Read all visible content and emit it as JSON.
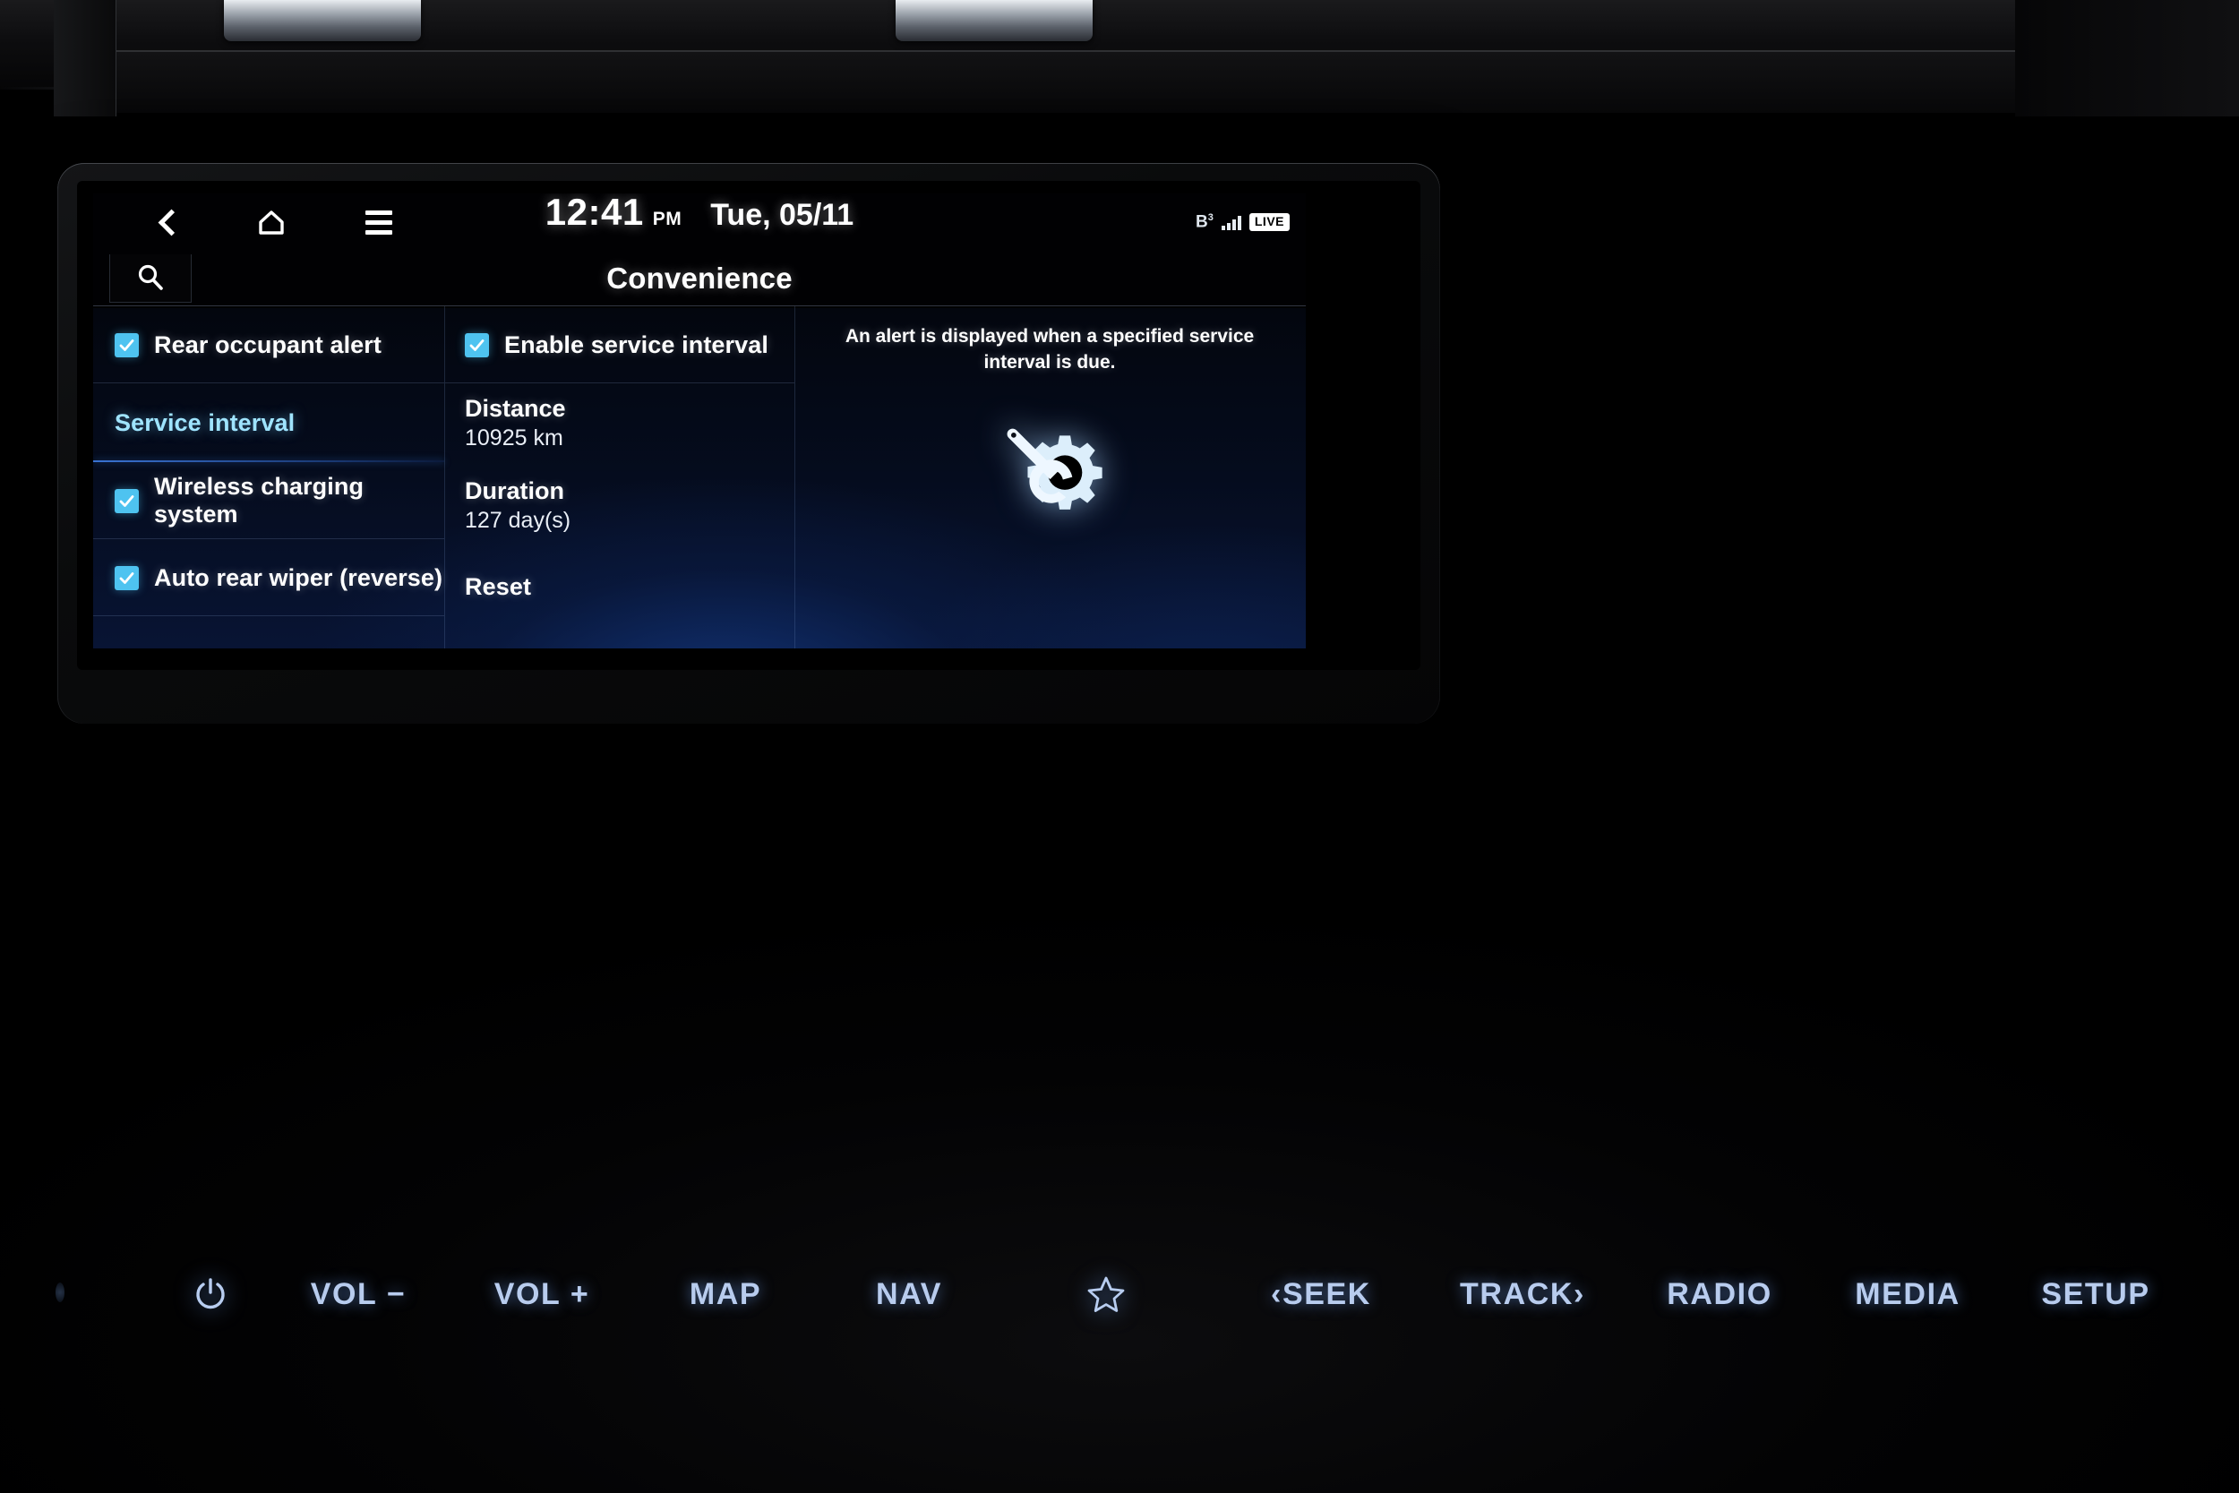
{
  "statusbar": {
    "back_icon": "chevron-left-icon",
    "home_icon": "home-icon",
    "menu_icon": "hamburger-menu-icon",
    "time": "12:41",
    "ampm": "PM",
    "date": "Tue, 05/11",
    "bluetooth_label": "B",
    "bluetooth_sup": "3",
    "live_label": "LIVE"
  },
  "titlebar": {
    "search_icon": "search-icon",
    "title": "Convenience"
  },
  "left_column": {
    "items": [
      {
        "label": "Rear occupant alert",
        "checkbox": true,
        "checked": true,
        "selected": false
      },
      {
        "label": "Service interval",
        "checkbox": false,
        "checked": false,
        "selected": true
      },
      {
        "label": "Wireless charging system",
        "checkbox": true,
        "checked": true,
        "selected": false
      },
      {
        "label": "Auto rear wiper (reverse)",
        "checkbox": true,
        "checked": true,
        "selected": false
      }
    ]
  },
  "middle_column": {
    "enable_label": "Enable service interval",
    "enable_checked": true,
    "distance_label": "Distance",
    "distance_value": "10925 km",
    "duration_label": "Duration",
    "duration_value": "127 day(s)",
    "reset_label": "Reset"
  },
  "right_column": {
    "description": "An alert is displayed when a specified service interval is due.",
    "illustration_icon": "gear-wrench-icon"
  },
  "hardware_buttons": [
    {
      "name": "power",
      "label": "",
      "icon": "power-icon"
    },
    {
      "name": "volume-down",
      "label": "VOL −",
      "icon": ""
    },
    {
      "name": "volume-up",
      "label": "VOL +",
      "icon": ""
    },
    {
      "name": "map",
      "label": "MAP",
      "icon": ""
    },
    {
      "name": "nav",
      "label": "NAV",
      "icon": ""
    },
    {
      "name": "favorite",
      "label": "",
      "icon": "star-icon"
    },
    {
      "name": "seek",
      "label": "‹SEEK",
      "icon": ""
    },
    {
      "name": "track",
      "label": "TRACK›",
      "icon": ""
    },
    {
      "name": "radio",
      "label": "RADIO",
      "icon": ""
    },
    {
      "name": "media",
      "label": "MEDIA",
      "icon": ""
    },
    {
      "name": "setup",
      "label": "SETUP",
      "icon": ""
    }
  ],
  "colors": {
    "accent_cyan": "#4ec3f0",
    "highlight_text": "#9fe4ff",
    "button_blue": "#b8ccee",
    "screen_navy": "#0a1c46"
  }
}
